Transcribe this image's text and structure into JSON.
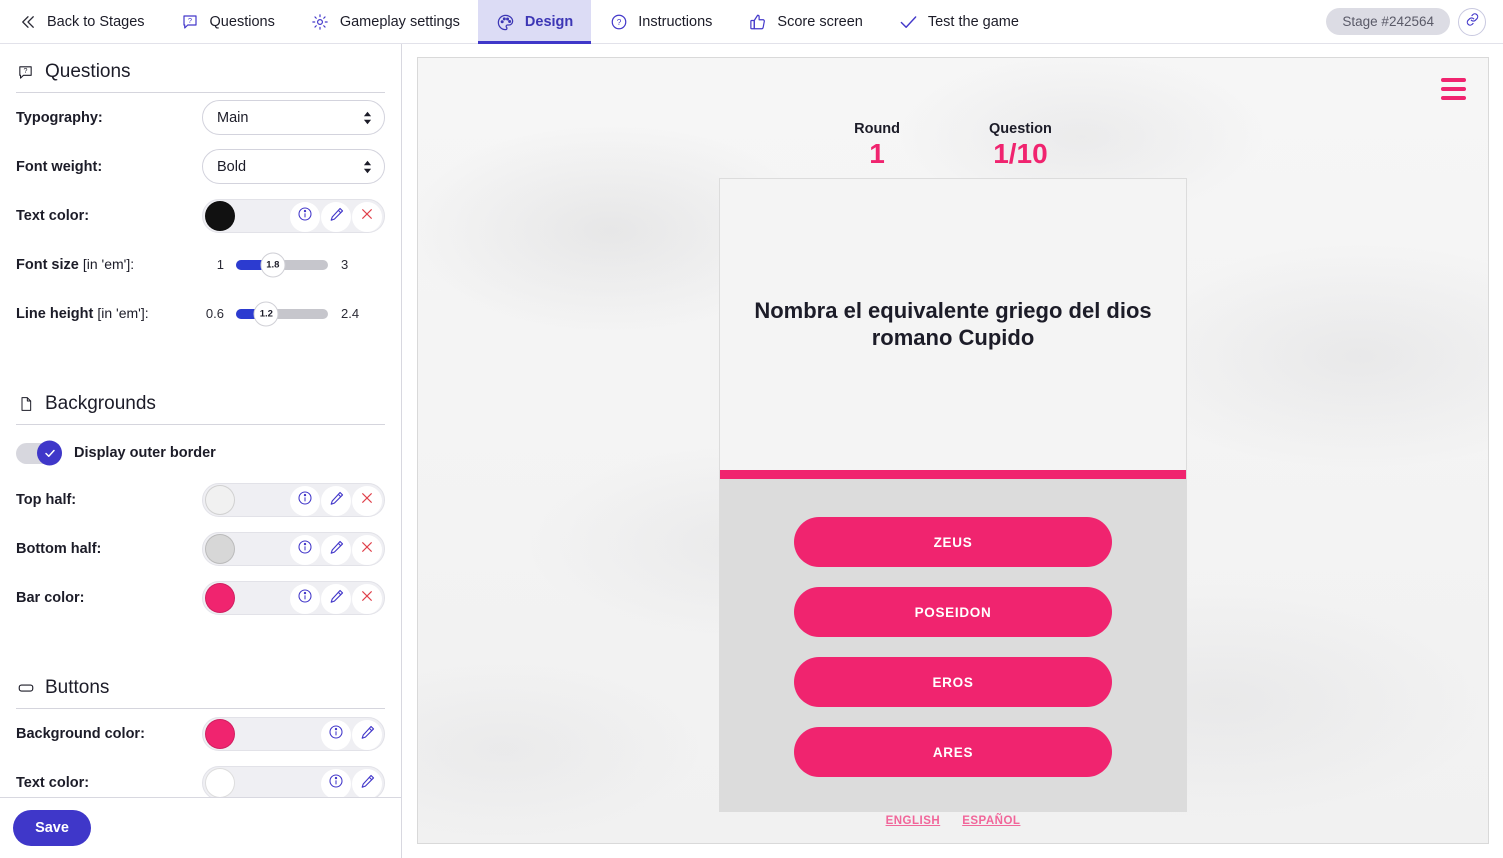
{
  "topnav": {
    "items": [
      {
        "label": "Back to Stages",
        "icon": "chevron-left-double-icon",
        "active": false
      },
      {
        "label": "Questions",
        "icon": "question-bubble-icon",
        "active": false
      },
      {
        "label": "Gameplay settings",
        "icon": "gear-icon",
        "active": false
      },
      {
        "label": "Design",
        "icon": "palette-icon",
        "active": true
      },
      {
        "label": "Instructions",
        "icon": "question-circle-icon",
        "active": false
      },
      {
        "label": "Score screen",
        "icon": "thumbs-up-icon",
        "active": false
      },
      {
        "label": "Test the game",
        "icon": "check-icon",
        "active": false
      }
    ],
    "stage_badge": "Stage #242564",
    "link_icon": "link-icon"
  },
  "sidebar": {
    "questions_section": {
      "title": "Questions",
      "icon": "question-bubble-icon",
      "typography": {
        "label": "Typography:",
        "value": "Main"
      },
      "font_weight": {
        "label": "Font weight:",
        "value": "Bold"
      },
      "text_color": {
        "label": "Text color:",
        "color": "#111111"
      },
      "font_size": {
        "label": "Font size",
        "unit": "[in 'em']:",
        "min": "1",
        "max": "3",
        "value": "1.8"
      },
      "line_height": {
        "label": "Line height",
        "unit": "[in 'em']:",
        "min": "0.6",
        "max": "2.4",
        "value": "1.2"
      }
    },
    "backgrounds_section": {
      "title": "Backgrounds",
      "icon": "document-icon",
      "display_outer_border": {
        "label": "Display outer border",
        "on": true
      },
      "top_half": {
        "label": "Top half:",
        "color": "#f1f1f1"
      },
      "bottom_half": {
        "label": "Bottom half:",
        "color": "#d7d7d7"
      },
      "bar_color": {
        "label": "Bar color:",
        "color": "#f0246f"
      }
    },
    "buttons_section": {
      "title": "Buttons",
      "icon": "button-icon",
      "background_color": {
        "label": "Background color:",
        "color": "#f0246f"
      },
      "text_color": {
        "label": "Text color:",
        "color": "#ffffff"
      }
    },
    "save_label": "Save",
    "control_icons": {
      "info": "info-icon",
      "edit": "pencil-icon",
      "clear": "close-x-icon"
    }
  },
  "preview": {
    "menu_icon": "hamburger-menu-icon",
    "round": {
      "label": "Round",
      "value": "1"
    },
    "question": {
      "label": "Question",
      "value": "1/10"
    },
    "question_text": "Nombra el equivalente griego del dios romano Cupido",
    "answers": [
      "ZEUS",
      "POSEIDON",
      "EROS",
      "ARES"
    ],
    "languages": [
      "ENGLISH",
      "ESPAÑOL"
    ]
  },
  "colors": {
    "accent_pink": "#f0246f",
    "accent_indigo": "#3f37c9",
    "active_tab_bg": "#dcdcf5"
  }
}
